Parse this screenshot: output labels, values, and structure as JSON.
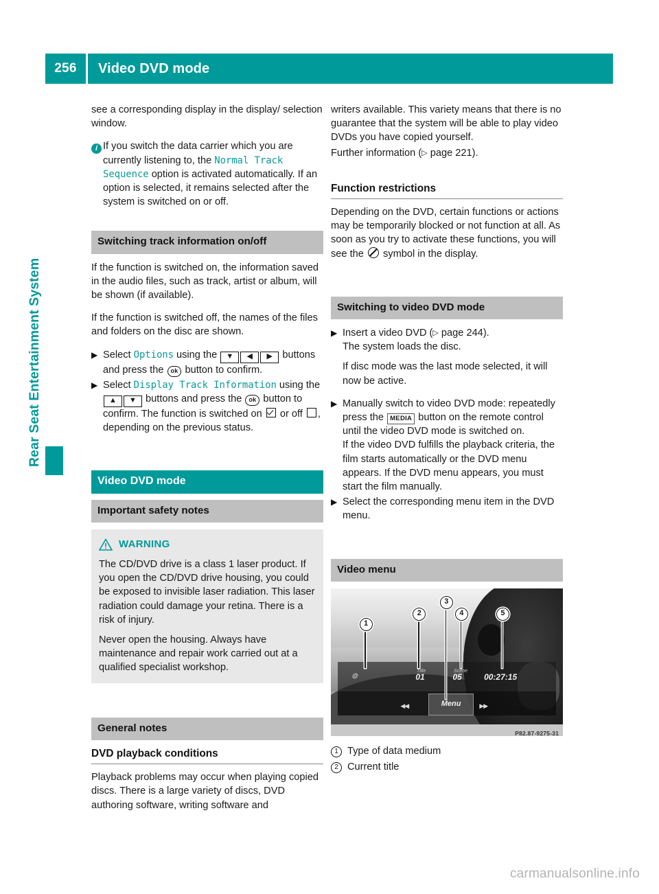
{
  "header": {
    "page_number": "256",
    "title": "Video DVD mode"
  },
  "sidebar": {
    "tab_label": "Rear Seat Entertainment System"
  },
  "left_column": {
    "continued_para": "see a corresponding display in the display/ selection window.",
    "info_note": {
      "icon": "info-icon",
      "text_before": "If you switch the data carrier which you are currently listening to, the ",
      "option_name": "Normal Track Sequence",
      "text_after": " option is activated automatically. If an option is selected, it remains selected after the system is switched on or off."
    },
    "section_track_info": {
      "heading": "Switching track information on/off",
      "para1": "If the function is switched on, the information saved in the audio files, such as track, artist or album, will be shown (if available).",
      "para2": "If the function is switched off, the names of the files and folders on the disc are shown.",
      "step1": {
        "prefix": "Select ",
        "target": "Options",
        "mid": " using the ",
        "keys": [
          "▼",
          "◀",
          "▶"
        ],
        "suffix_before_ok": " buttons and press the ",
        "ok_key": "ok",
        "suffix_after_ok": " button to confirm."
      },
      "step2": {
        "prefix": "Select ",
        "target": "Display Track Information",
        "mid": " using the ",
        "keys": [
          "▲",
          "▼"
        ],
        "suffix_before_ok": " buttons and press the ",
        "ok_key": "ok",
        "suffix_after_ok": " button to confirm.",
        "status_prefix": "The function is switched on ",
        "status_mid": " or off ",
        "status_suffix": ", depending on the previous status."
      }
    },
    "section_video_dvd": {
      "heading": "Video DVD mode"
    },
    "section_safety": {
      "heading": "Important safety notes",
      "warning_label": "WARNING",
      "warning_icon": "warning-triangle-icon",
      "warning_para1": "The CD/DVD drive is a class 1 laser product. If you open the CD/DVD drive housing, you could be exposed to invisible laser radiation. This laser radiation could damage your retina. There is a risk of injury.",
      "warning_para2": "Never open the housing. Always have maintenance and repair work carried out at a qualified specialist workshop."
    },
    "section_general": {
      "heading": "General notes",
      "sub_heading": "DVD playback conditions",
      "para": "Playback problems may occur when playing copied discs. There is a large variety of discs, DVD authoring software, writing software and"
    }
  },
  "right_column": {
    "continued_para": "writers available. This variety means that there is no guarantee that the system will be able to play video DVDs you have copied yourself.",
    "further_info": {
      "prefix": "Further information (",
      "page_ref_icon": "▷",
      "page_ref": " page 221",
      "suffix": ")."
    },
    "section_function_restrictions": {
      "heading": "Function restrictions",
      "text_before": "Depending on the DVD, certain functions or actions may be temporarily blocked or not function at all. As soon as you try to activate these functions, you will see the ",
      "symbol_name": "no-entry-icon",
      "text_after": " symbol in the display."
    },
    "section_switching": {
      "heading": "Switching to video DVD mode",
      "step1": {
        "prefix": "Insert a video DVD (",
        "page_ref_icon": "▷",
        "page_ref": " page 244",
        "suffix": ").",
        "sub1": "The system loads the disc.",
        "sub2": "If disc mode was the last mode selected, it will now be active."
      },
      "step2": {
        "prefix": "Manually switch to video DVD mode: repeatedly press the ",
        "key_label": "MEDIA",
        "suffix": " button on the remote control until the video DVD mode is switched on.",
        "sub1": "If the video DVD fulfills the playback criteria, the film starts automatically or the DVD menu appears. If the DVD menu appears, you must start the film manually."
      },
      "step3": "Select the corresponding menu item in the DVD menu."
    },
    "section_video_menu": {
      "heading": "Video menu",
      "figure": {
        "credit": "P82.87-9275-31",
        "osd": {
          "title_label": "Title",
          "title_value": "01",
          "scene_label": "Scene",
          "scene_value": "05",
          "time_value": "00:27:15",
          "menu_button": "Menu",
          "prev_icon": "skip-back-icon",
          "next_icon": "skip-forward-icon",
          "medium_icon": "disc-icon"
        },
        "markers": [
          "1",
          "2",
          "3",
          "4",
          "5"
        ]
      },
      "captions": [
        {
          "num": "1",
          "text": "Type of data medium"
        },
        {
          "num": "2",
          "text": "Current title"
        }
      ]
    }
  },
  "footer": {
    "watermark": "carmanualsonline.info"
  }
}
